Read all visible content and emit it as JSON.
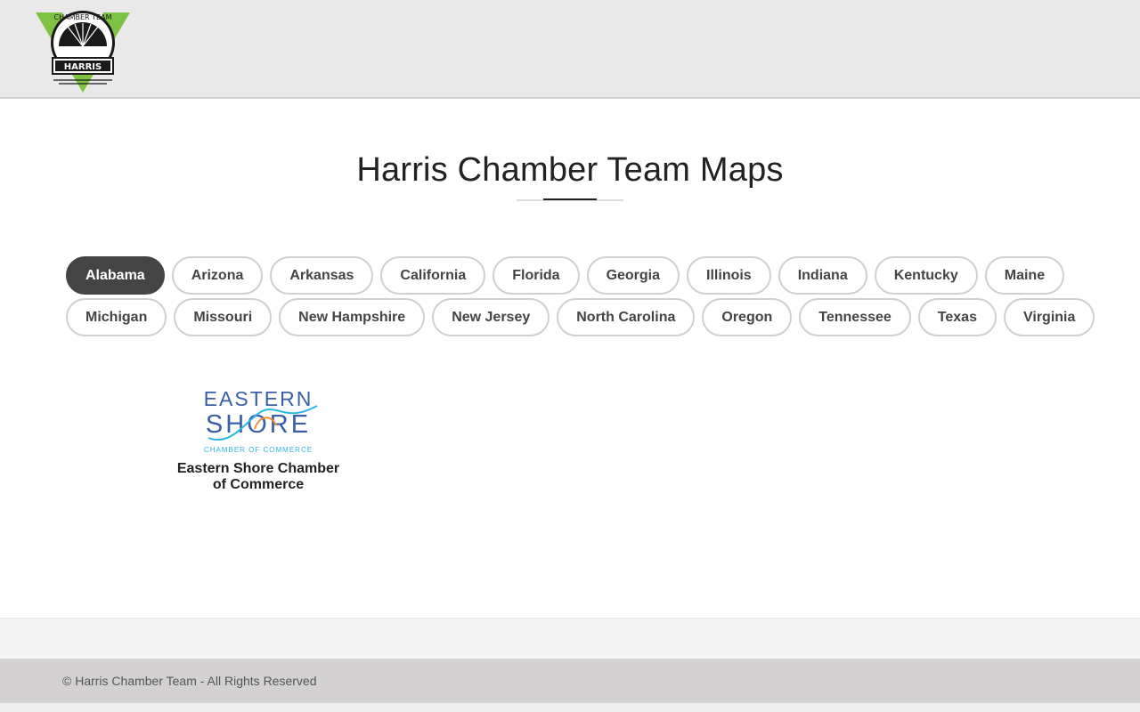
{
  "header": {
    "logo": {
      "top_text": "CHAMBER TEAM",
      "bottom_text": "HARRIS",
      "icon": "harris-chamber-team-logo"
    }
  },
  "main": {
    "title": "Harris Chamber Team Maps",
    "filters": {
      "row1": [
        "Alabama",
        "Arizona",
        "Arkansas",
        "California",
        "Florida",
        "Georgia",
        "Illinois",
        "Indiana",
        "Kentucky",
        "Maine"
      ],
      "row2": [
        "Michigan",
        "Missouri",
        "New Hampshire",
        "New Jersey",
        "North Carolina",
        "Oregon",
        "Tennessee",
        "Texas",
        "Virginia"
      ],
      "active": "Alabama"
    },
    "cards": [
      {
        "name": "Eastern Shore Chamber of Commerce",
        "logo": {
          "line1": "EASTERN",
          "line2": "SHORE",
          "line3": "CHAMBER OF COMMERCE",
          "icon": "eastern-shore-logo"
        }
      }
    ]
  },
  "footer": {
    "copyright": "© Harris Chamber Team - All Rights Reserved"
  },
  "colors": {
    "active_pill": "#444444",
    "pill_border": "#d0d0d0",
    "header_bg": "#e9e9e9",
    "footer_bg": "#d3d1d1",
    "logo_green": "#7dc242",
    "es_blue": "#3a5fa8",
    "es_cyan": "#2bb5e8",
    "es_orange": "#f28c3a"
  }
}
